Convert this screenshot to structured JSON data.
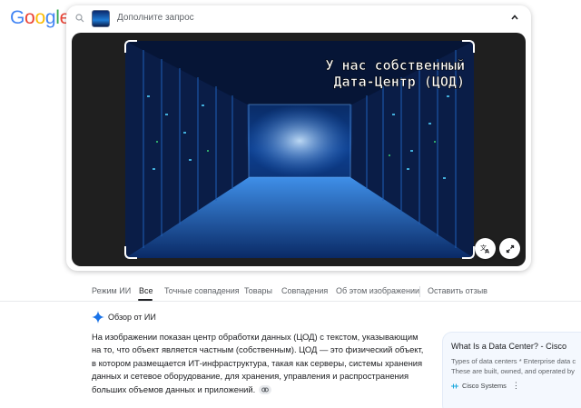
{
  "logo": {
    "text": "Google",
    "letters": [
      "G",
      "o",
      "o",
      "g",
      "l",
      "e"
    ],
    "colors": [
      "#4285F4",
      "#EA4335",
      "#FBBC05",
      "#4285F4",
      "#34A853",
      "#EA4335"
    ]
  },
  "search": {
    "placeholder": "Дополните запрос"
  },
  "image": {
    "overlay_text_line1": "У нас собственный",
    "overlay_text_line2": "Дата-Центр (ЦОД)"
  },
  "tabs": [
    {
      "label": "Режим ИИ",
      "active": false
    },
    {
      "label": "Все",
      "active": true
    },
    {
      "label": "Точные совпадения",
      "active": false
    },
    {
      "label": "Товары",
      "active": false
    },
    {
      "label": "Совпадения",
      "active": false
    },
    {
      "label": "Об этом изображении",
      "active": false
    },
    {
      "label": "Оставить отзыв",
      "active": false
    }
  ],
  "ai_overview": {
    "label": "Обзор от ИИ",
    "text": "На изображении показан центр обработки данных (ЦОД) с текстом, указывающим на то, что объект является частным (собственным). ЦОД — это физический объект, в котором размещается ИТ-инфраструктура, такая как серверы, системы хранения данных и сетевое оборудование, для хранения, управления и распространения больших объемов данных и приложений."
  },
  "result_card": {
    "title": "What Is a Data Center? - Cisco",
    "snippet_line1": "Types of data centers * Enterprise data c",
    "snippet_line2": "These are built, owned, and operated by",
    "source": "Cisco Systems"
  },
  "colors": {
    "accent": "#1a73e8",
    "panel_bg": "#1f1f1f"
  }
}
